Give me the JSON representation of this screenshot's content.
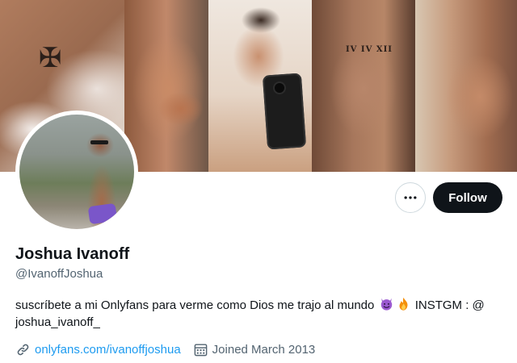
{
  "actions": {
    "more_icon": "more-horizontal-icon",
    "follow_label": "Follow"
  },
  "profile": {
    "display_name": "Joshua Ivanoff",
    "handle": "@IvanoffJoshua",
    "bio_part1": "suscríbete a mi Onlyfans para verme como Dios me trajo al mundo",
    "bio_emojis": [
      "smiling-devil-emoji",
      "fire-emoji"
    ],
    "bio_part2": "INSTGM : @ joshua_ivanoff_",
    "website": "onlyfans.com/ivanoffjoshua",
    "joined": "Joined March 2013"
  },
  "banner": {
    "tattoo_text": "IV IV XII"
  },
  "colors": {
    "link": "#1d9bf0",
    "follow_bg": "#0f1419",
    "secondary_text": "#536471"
  }
}
